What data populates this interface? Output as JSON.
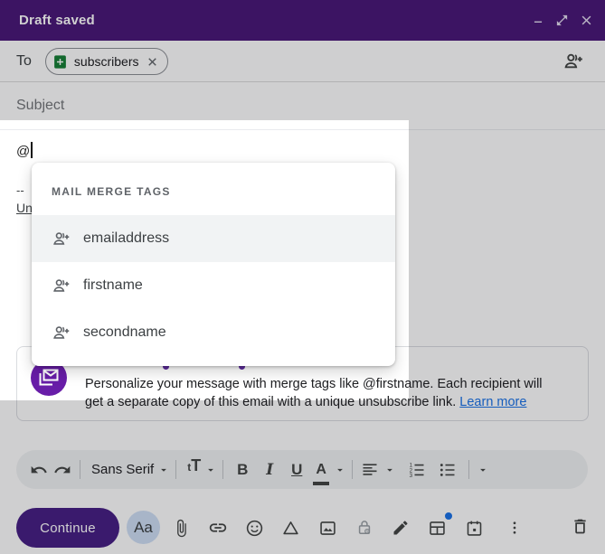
{
  "titlebar": {
    "title": "Draft saved"
  },
  "to_row": {
    "label": "To",
    "chip_label": "subscribers"
  },
  "subject_row": {
    "placeholder": "Subject"
  },
  "body": {
    "typed_text": "@",
    "signature_dashes": "--",
    "signature_link_visible": "Un"
  },
  "merge_menu": {
    "header": "MAIL MERGE TAGS",
    "items": [
      {
        "label": "emailaddress"
      },
      {
        "label": "firstname"
      },
      {
        "label": "secondname"
      }
    ]
  },
  "info_box": {
    "line1": "Personalize your message with merge tags like @firstname. Each recipient will",
    "line2": "get a separate copy of this email with a unique unsubscribe link. ",
    "link_label": "Learn more"
  },
  "format_toolbar": {
    "font_family_label": "Sans Serif",
    "size_small": "t",
    "size_large": "T",
    "bold": "B",
    "italic": "I",
    "underline": "U",
    "text_color": "A"
  },
  "bottom_bar": {
    "continue_label": "Continue",
    "formatting_toggle": "Aa"
  },
  "colors": {
    "header_purple": "#4b1979",
    "button_purple": "#482086",
    "accent_blue": "#1a73e8",
    "sheets_green": "#188038",
    "merge_icon_purple": "#681da8"
  }
}
